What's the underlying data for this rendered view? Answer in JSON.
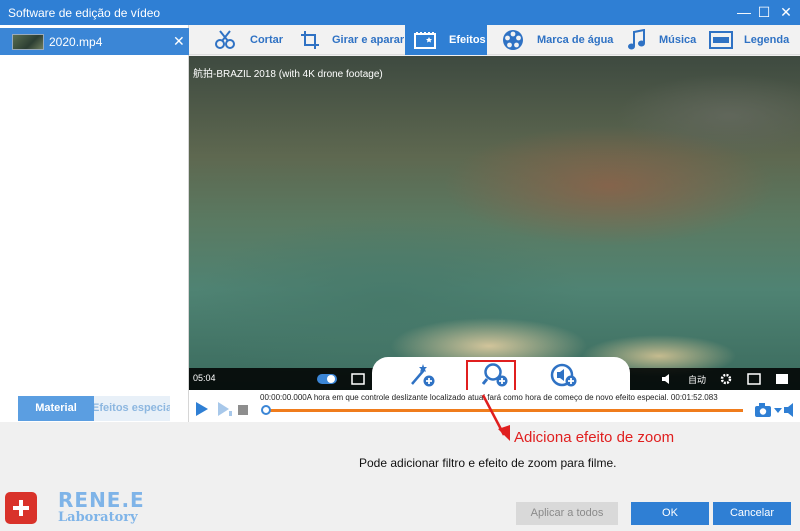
{
  "window": {
    "title": "Software de edição de vídeo",
    "minimize": "—",
    "maximize": "☐",
    "close": "✕"
  },
  "file_list": {
    "items": [
      {
        "name": "2020.mp4",
        "close": "✕"
      }
    ]
  },
  "left_tabs": {
    "material": "Material",
    "special_effects": "Efeitos especiais"
  },
  "toolbar": {
    "items": [
      {
        "label": "Cortar",
        "icon": "scissors-icon"
      },
      {
        "label": "Girar e aparar",
        "icon": "crop-rotate-icon"
      },
      {
        "label": "Efeitos",
        "icon": "film-effects-icon",
        "active": true
      },
      {
        "label": "Marca de água",
        "icon": "film-reel-icon"
      },
      {
        "label": "Música",
        "icon": "music-note-icon"
      },
      {
        "label": "Legenda",
        "icon": "subtitle-icon"
      }
    ]
  },
  "video": {
    "title": "航拍-BRAZIL 2018 (with 4K drone footage)",
    "current_time": "05:04",
    "autoplay_label": "自动"
  },
  "effects_popup": {
    "buttons": [
      "add-filter-icon",
      "add-zoom-icon",
      "add-volume-icon"
    ]
  },
  "timeline": {
    "text": "00:00:00.000A hora em que controle deslizante localizado atual fará como hora de começo de novo efeito especial. 00:01:52.083"
  },
  "annotation": {
    "text": "Adiciona efeito de zoom"
  },
  "hint": {
    "text": "Pode adicionar filtro e efeito de zoom para filme."
  },
  "branding": {
    "name": "RENE.E",
    "sub": "Laboratory"
  },
  "buttons": {
    "apply_all": "Aplicar a todos",
    "ok": "OK",
    "cancel": "Cancelar"
  },
  "colors": {
    "accent": "#2f7fd4",
    "annotation": "#e01f1f",
    "timeline_track": "#f07c1c"
  }
}
